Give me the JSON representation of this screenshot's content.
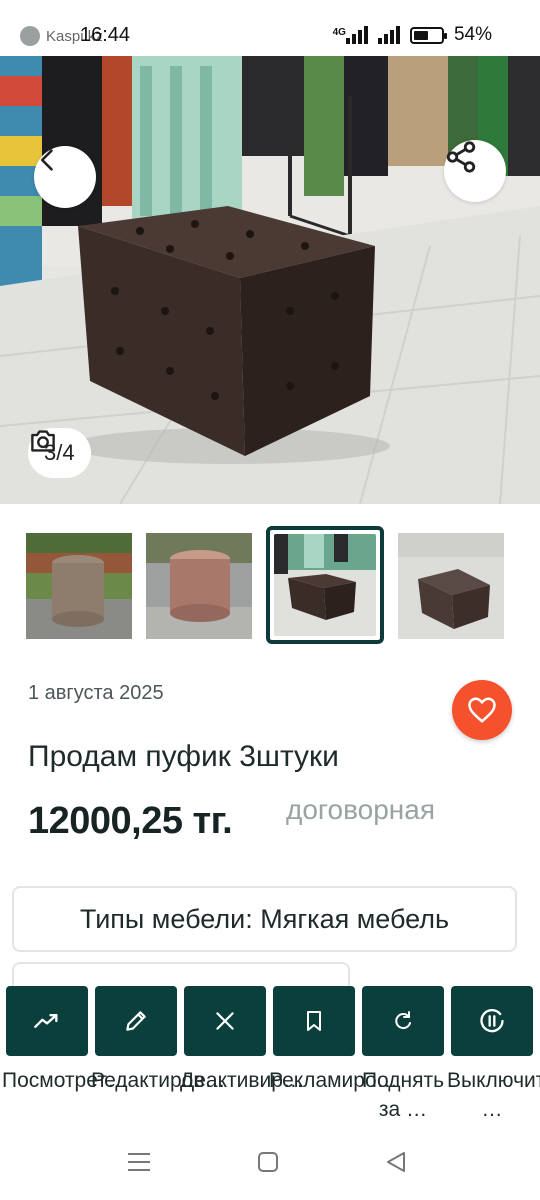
{
  "status_bar": {
    "time": "16:44",
    "carrier": "Kaspi.kz",
    "network": "4G",
    "battery_percent": "54%",
    "battery_level": 0.54
  },
  "hero": {
    "photo_counter": "3/4",
    "back_icon": "chevron-left-icon",
    "share_icon": "share-icon",
    "camera_icon": "camera-icon"
  },
  "thumbnails": {
    "count": 4,
    "active_index": 2
  },
  "listing": {
    "date": "1 августа 2025",
    "title": "Продам пуфик 3штуки",
    "price": "12000,25 тг.",
    "negotiable": "договорная",
    "attribute": "Типы мебели: Мягкая мебель"
  },
  "actions": [
    {
      "label": "Посмотрет…",
      "icon": "trending-up-icon"
    },
    {
      "label": "Редактиров…",
      "icon": "pencil-icon"
    },
    {
      "label": "Деактивир…",
      "icon": "close-icon"
    },
    {
      "label": "Рекламиро…",
      "icon": "bookmark-icon"
    },
    {
      "label": "Поднять за …",
      "icon": "refresh-icon"
    },
    {
      "label": "Выключить …",
      "icon": "pause-circle-icon"
    }
  ],
  "colors": {
    "accent_dark": "#0b3f3c",
    "favorite": "#f4512c"
  }
}
